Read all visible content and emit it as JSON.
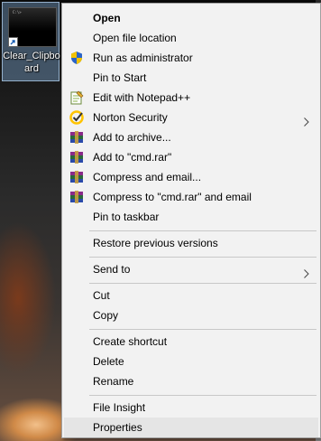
{
  "desktop": {
    "icon_label": "Clear_Clipboard",
    "thumb_text": "C:\\>"
  },
  "menu": {
    "open": "Open",
    "open_file_location": "Open file location",
    "run_as_admin": "Run as administrator",
    "pin_to_start": "Pin to Start",
    "edit_notepad": "Edit with Notepad++",
    "norton": "Norton Security",
    "add_archive": "Add to archive...",
    "add_cmd_rar": "Add to \"cmd.rar\"",
    "compress_email": "Compress and email...",
    "compress_cmd_email": "Compress to \"cmd.rar\" and email",
    "pin_taskbar": "Pin to taskbar",
    "restore_versions": "Restore previous versions",
    "send_to": "Send to",
    "cut": "Cut",
    "copy": "Copy",
    "create_shortcut": "Create shortcut",
    "delete": "Delete",
    "rename": "Rename",
    "file_insight": "File Insight",
    "properties": "Properties"
  },
  "colors": {
    "menu_bg": "#f2f2f2",
    "hover_bg": "#e5e5e5",
    "separator": "#c8c8c8",
    "shield_blue": "#2a64c8",
    "shield_yellow": "#f2c200",
    "norton_yellow": "#ffc400"
  }
}
